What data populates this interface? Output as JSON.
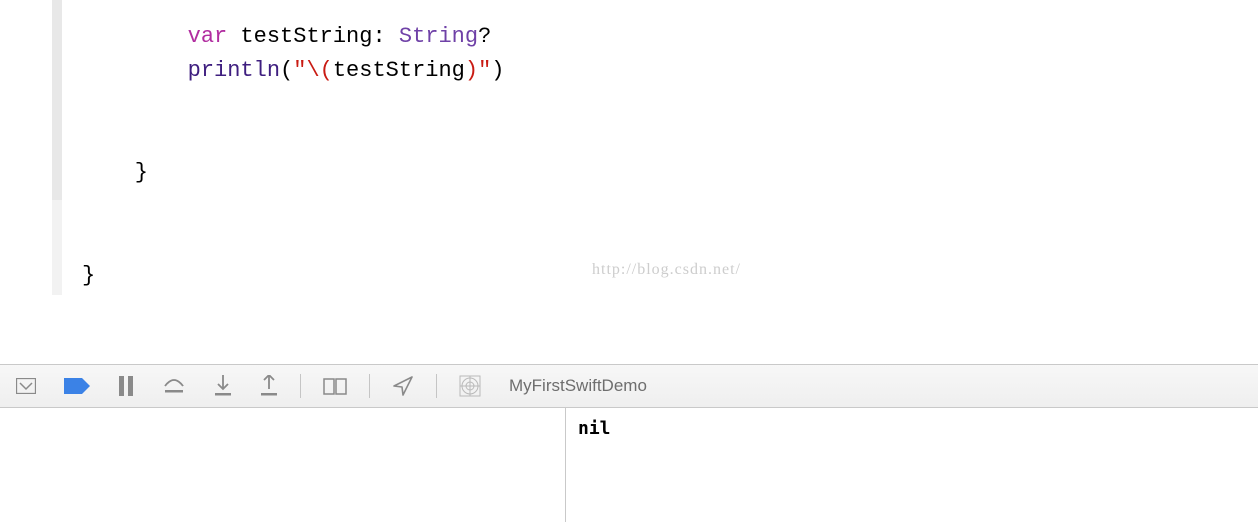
{
  "code": {
    "line1": {
      "indent": "        ",
      "kw": "var",
      "ident": " testString: ",
      "type": "String",
      "suffix": "?"
    },
    "line2": {
      "indent": "        ",
      "fn": "println",
      "open": "(",
      "str1": "\"",
      "interp_open": "\\(",
      "expr": "testString",
      "interp_close": ")",
      "str2": "\"",
      "close": ")"
    },
    "line3": "",
    "line4": "",
    "line5": "    }",
    "line6": "",
    "line7": "",
    "line8": "}"
  },
  "watermark": "http://blog.csdn.net/",
  "toolbar": {
    "scheme": "MyFirstSwiftDemo"
  },
  "console": {
    "output": "nil"
  }
}
